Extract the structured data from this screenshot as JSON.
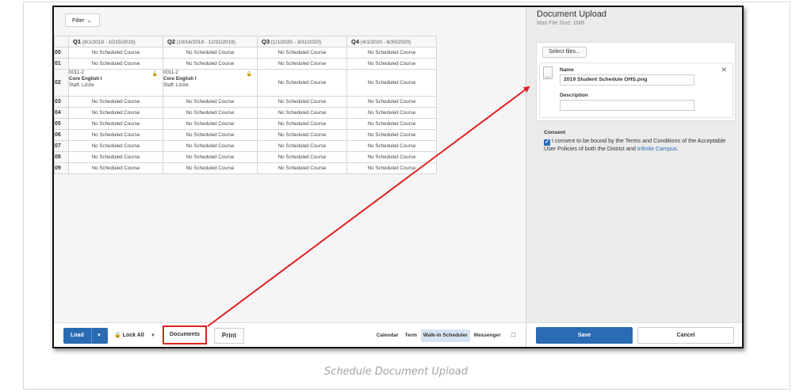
{
  "filter": {
    "label": "Filter",
    "chevron_icon": "chevron-down-icon"
  },
  "schedule": {
    "terms": [
      {
        "name": "Q1",
        "range": "(8/1/2019 - 10/15/2019)"
      },
      {
        "name": "Q2",
        "range": "(10/16/2019 - 12/31/2019)"
      },
      {
        "name": "Q3",
        "range": "(1/1/2020 - 3/31/2020)"
      },
      {
        "name": "Q4",
        "range": "(4/1/2020 - 6/30/2020)"
      }
    ],
    "empty_label": "No Scheduled Course",
    "periods": [
      "00",
      "01",
      "02",
      "03",
      "04",
      "05",
      "06",
      "07",
      "08",
      "09"
    ],
    "course": {
      "section": "0011-2",
      "name": "Core English I",
      "teacher": "Staff, Lizzie",
      "lock_icon": "lock-icon"
    }
  },
  "toolbar": {
    "load": "Load",
    "lock_all": "Lock All",
    "documents": "Documents",
    "print": "Print",
    "tabs": [
      "Calendar",
      "Term",
      "Walk-in Scheduler",
      "Messenger"
    ],
    "active_tab": "Walk-in Scheduler",
    "expand_icon": "expand-icon"
  },
  "panel": {
    "title": "Document Upload",
    "subtitle": "Max File Size: 1MB",
    "select_files": "Select files...",
    "file_icon_text": "PNG",
    "name_label": "Name",
    "name_value": "2019 Student Schedule OHS.png",
    "description_label": "Description",
    "description_value": "",
    "consent_label": "Consent",
    "consent_text_1": "I consent to be bound by the Terms and Conditions of the Acceptable User Policies of both the District and ",
    "consent_link": "Infinite Campus",
    "consent_text_2": ".",
    "consent_checked": true,
    "save": "Save",
    "cancel": "Cancel"
  },
  "caption": "Schedule Document Upload",
  "colors": {
    "accent": "#2a6bb3",
    "highlight": "#e02020",
    "active_tab": "#d7e4f2"
  }
}
